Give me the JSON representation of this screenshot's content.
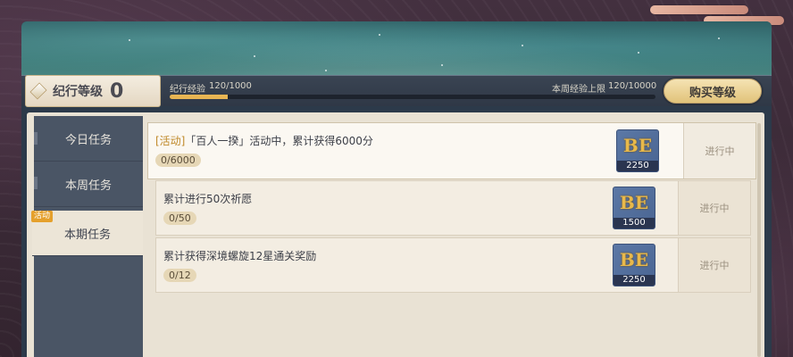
{
  "header": {
    "level_label": "纪行等级",
    "level_value": "0",
    "exp_label": "纪行经验",
    "exp_value": "120/1000",
    "exp_progress": 0.12,
    "weekly_cap_label": "本周经验上限",
    "weekly_cap_value": "120/10000",
    "buy_level_label": "购买等级"
  },
  "sidebar": {
    "items": [
      {
        "label": "今日任务",
        "active": false
      },
      {
        "label": "本周任务",
        "active": false
      },
      {
        "label": "本期任务",
        "active": true,
        "badge": "活动"
      }
    ]
  },
  "tasks": [
    {
      "tag": "[活动]",
      "title": "「百人一揆」活动中，累计获得6000分",
      "progress": "0/6000",
      "reward_count": "2250",
      "status": "进行中"
    },
    {
      "tag": "",
      "title": "累计进行50次祈愿",
      "progress": "0/50",
      "reward_count": "1500",
      "status": "进行中"
    },
    {
      "tag": "",
      "title": "累计获得深境螺旋12星通关奖励",
      "progress": "0/12",
      "reward_count": "2250",
      "status": "进行中"
    }
  ],
  "icons": {
    "level_gem": "diamond-icon",
    "reward": "battle-pass-exp-icon"
  },
  "colors": {
    "accent_gold": "#e8b553",
    "tag_orange": "#c08a2b",
    "sidebar_bg": "#4a5565"
  }
}
